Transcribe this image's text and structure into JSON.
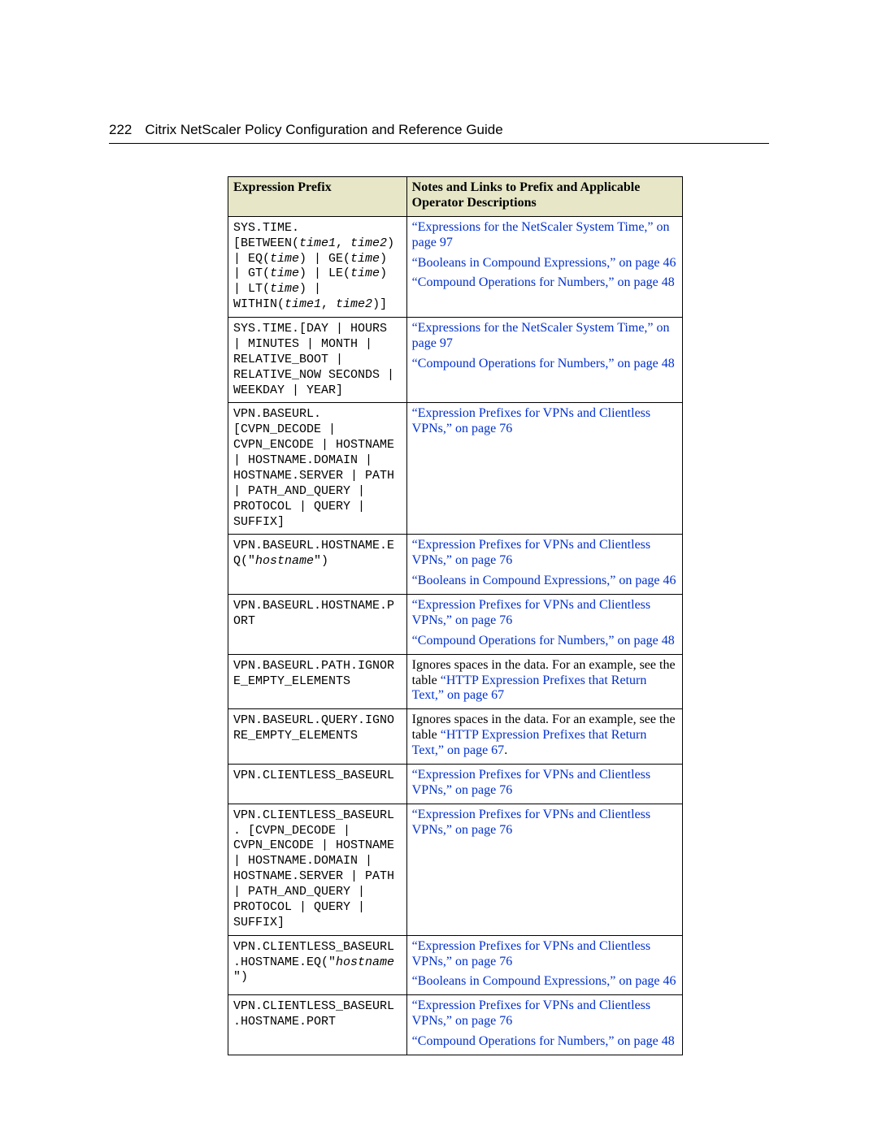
{
  "page_number": "222",
  "header_title": "Citrix NetScaler Policy Configuration and Reference Guide",
  "table": {
    "headers": {
      "col1": "Expression Prefix",
      "col2": "Notes and Links to Prefix and Applicable Operator Descriptions"
    }
  },
  "rows": [
    {
      "prefix": {
        "segments": [
          {
            "t": "SYS.TIME.[BETWEEN("
          },
          {
            "t": "time1",
            "i": true
          },
          {
            "t": ", "
          },
          {
            "t": "time2",
            "i": true
          },
          {
            "t": ") | EQ("
          },
          {
            "t": "time",
            "i": true
          },
          {
            "t": ") | GE("
          },
          {
            "t": "time",
            "i": true
          },
          {
            "t": ") | GT("
          },
          {
            "t": "time",
            "i": true
          },
          {
            "t": ") | LE("
          },
          {
            "t": "time",
            "i": true
          },
          {
            "t": ") | LT("
          },
          {
            "t": "time",
            "i": true
          },
          {
            "t": ") | WITHIN("
          },
          {
            "t": "time1",
            "i": true
          },
          {
            "t": ", "
          },
          {
            "t": "time2",
            "i": true
          },
          {
            "t": ")]"
          }
        ]
      },
      "notes": [
        {
          "pre": "",
          "link": "“Expressions for the NetScaler System Time,” on page 97",
          "post": ""
        },
        {
          "pre": "",
          "link": "“Booleans in Compound Expressions,” on page 46",
          "post": ""
        },
        {
          "pre": "",
          "link": "“Compound Operations for Numbers,” on page 48",
          "post": ""
        }
      ]
    },
    {
      "prefix": {
        "segments": [
          {
            "t": "SYS.TIME.[DAY | HOURS | MINUTES | MONTH | RELATIVE_BOOT | RELATIVE_NOW SECONDS | WEEKDAY | YEAR]"
          }
        ]
      },
      "notes": [
        {
          "pre": "",
          "link": "“Expressions for the NetScaler System Time,” on page 97",
          "post": ""
        },
        {
          "pre": "",
          "link": "“Compound Operations for Numbers,” on page 48",
          "post": ""
        }
      ]
    },
    {
      "prefix": {
        "segments": [
          {
            "t": "VPN.BASEURL.[CVPN_DECODE | CVPN_ENCODE | HOSTNAME | HOSTNAME.DOMAIN | HOSTNAME.SERVER | PATH | PATH_AND_QUERY | PROTOCOL | QUERY | SUFFIX]"
          }
        ]
      },
      "notes": [
        {
          "pre": "",
          "link": "“Expression Prefixes for VPNs and Clientless VPNs,” on page 76",
          "post": ""
        }
      ]
    },
    {
      "prefix": {
        "segments": [
          {
            "t": "VPN.BASEURL.HOSTNAME.EQ(\""
          },
          {
            "t": "hostname",
            "i": true
          },
          {
            "t": "\")"
          }
        ]
      },
      "notes": [
        {
          "pre": "",
          "link": "“Expression Prefixes for VPNs and Clientless VPNs,” on page 76",
          "post": ""
        },
        {
          "pre": "",
          "link": "“Booleans in Compound Expressions,” on page 46",
          "post": ""
        }
      ]
    },
    {
      "prefix": {
        "segments": [
          {
            "t": "VPN.BASEURL.HOSTNAME.PORT"
          }
        ]
      },
      "notes": [
        {
          "pre": "",
          "link": "“Expression Prefixes for VPNs and Clientless VPNs,” on page 76",
          "post": ""
        },
        {
          "pre": "",
          "link": "“Compound Operations for Numbers,” on page 48",
          "post": ""
        }
      ]
    },
    {
      "prefix": {
        "segments": [
          {
            "t": "VPN.BASEURL.PATH.IGNORE_EMPTY_ELEMENTS"
          }
        ]
      },
      "notes": [
        {
          "pre": "Ignores spaces in the data. For an example, see the table ",
          "link": "“HTTP Expression Prefixes that Return Text,” on page 67",
          "post": ""
        }
      ]
    },
    {
      "prefix": {
        "segments": [
          {
            "t": "VPN.BASEURL.QUERY.IGNORE_EMPTY_ELEMENTS"
          }
        ]
      },
      "notes": [
        {
          "pre": "Ignores spaces in the data. For an example, see the table ",
          "link": "“HTTP Expression Prefixes that Return Text,” on page 67",
          "post": "."
        }
      ]
    },
    {
      "prefix": {
        "segments": [
          {
            "t": "VPN.CLIENTLESS_BASEURL"
          }
        ]
      },
      "notes": [
        {
          "pre": "",
          "link": "“Expression Prefixes for VPNs and Clientless VPNs,” on page 76",
          "post": ""
        }
      ]
    },
    {
      "prefix": {
        "segments": [
          {
            "t": "VPN.CLIENTLESS_BASEURL. [CVPN_DECODE | CVPN_ENCODE | HOSTNAME | HOSTNAME.DOMAIN | HOSTNAME.SERVER | PATH | PATH_AND_QUERY | PROTOCOL | QUERY | SUFFIX]"
          }
        ]
      },
      "notes": [
        {
          "pre": "",
          "link": "“Expression Prefixes for VPNs and Clientless VPNs,” on page 76",
          "post": ""
        }
      ]
    },
    {
      "prefix": {
        "segments": [
          {
            "t": "VPN.CLIENTLESS_BASEURL.HOSTNAME.EQ(\""
          },
          {
            "t": "hostname",
            "i": true
          },
          {
            "t": "\")"
          }
        ]
      },
      "notes": [
        {
          "pre": "",
          "link": "“Expression Prefixes for VPNs and Clientless VPNs,” on page 76",
          "post": ""
        },
        {
          "pre": "",
          "link": "“Booleans in Compound Expressions,” on page 46",
          "post": ""
        }
      ]
    },
    {
      "prefix": {
        "segments": [
          {
            "t": "VPN.CLIENTLESS_BASEURL.HOSTNAME.PORT"
          }
        ]
      },
      "notes": [
        {
          "pre": "",
          "link": "“Expression Prefixes for VPNs and Clientless VPNs,” on page 76",
          "post": ""
        },
        {
          "pre": "",
          "link": "“Compound Operations for Numbers,” on page 48",
          "post": ""
        }
      ]
    }
  ]
}
